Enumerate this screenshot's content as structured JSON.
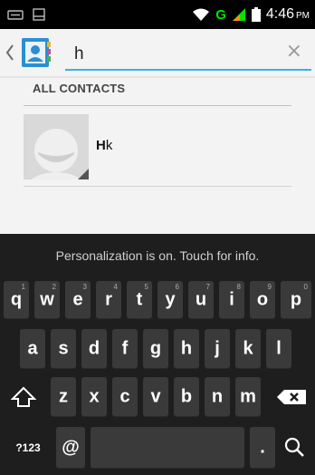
{
  "status_bar": {
    "network_letter": "G",
    "time": "4:46",
    "ampm": "PM"
  },
  "search": {
    "query": "h",
    "clear_label": "×"
  },
  "list": {
    "section_header": "ALL CONTACTS",
    "contacts": [
      {
        "name_match": "H",
        "name_rest": "k"
      }
    ]
  },
  "keyboard": {
    "banner": "Personalization is on. Touch for info.",
    "row1": [
      {
        "key": "q",
        "num": "1"
      },
      {
        "key": "w",
        "num": "2"
      },
      {
        "key": "e",
        "num": "3"
      },
      {
        "key": "r",
        "num": "4"
      },
      {
        "key": "t",
        "num": "5"
      },
      {
        "key": "y",
        "num": "6"
      },
      {
        "key": "u",
        "num": "7"
      },
      {
        "key": "i",
        "num": "8"
      },
      {
        "key": "o",
        "num": "9"
      },
      {
        "key": "p",
        "num": "0"
      }
    ],
    "row2": [
      "a",
      "s",
      "d",
      "f",
      "g",
      "h",
      "j",
      "k",
      "l"
    ],
    "row3": [
      "z",
      "x",
      "c",
      "v",
      "b",
      "n",
      "m"
    ],
    "symbols_label": "?123",
    "at_label": "@",
    "period_label": "."
  },
  "icons": {
    "back": "chevron-left-icon",
    "app": "contacts-icon",
    "shift": "shift-icon",
    "delete": "backspace-icon",
    "search": "search-icon"
  }
}
